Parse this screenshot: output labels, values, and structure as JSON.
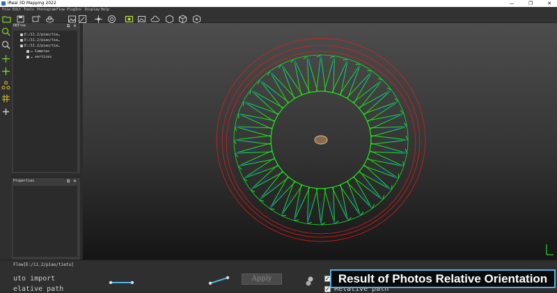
{
  "window": {
    "title": "iReal 3D Mapping 2022",
    "min_glyph": "—",
    "max_glyph": "❐",
    "close_glyph": "✕"
  },
  "menu": [
    "File",
    "Edit",
    "Tools",
    "Photogram",
    "Flow",
    "PlugIns",
    "Display",
    "Help"
  ],
  "toolbar_icons": [
    "open-folder-icon",
    "save-icon",
    "import-photos-icon",
    "cloud-add-icon",
    "image-icon",
    "edit-image-icon",
    "drone-icon",
    "target-icon",
    "photo-align-icon",
    "point-cloud-icon",
    "cloud-icon",
    "cube-icon",
    "cube-grid-icon",
    "settings-cube-icon"
  ],
  "left_tools": [
    "zoom-fit-icon",
    "zoom-icon",
    "crosshair-icon",
    "move-icon",
    "connect-points-icon",
    "grid-icon",
    "add-point-icon"
  ],
  "dbtree": {
    "title": "DBTree",
    "float_glyph": "⧉",
    "close_glyph": "✕",
    "rows": [
      "E:/11.2/piao/tie…",
      "E:/11.2/piao/tie…",
      "E:/11.2/piao/tie…",
      "Cameras",
      "vertices"
    ]
  },
  "properties": {
    "title": "Properties",
    "float_glyph": "⧉",
    "close_glyph": "✕"
  },
  "flow": {
    "title": "Flow[E:/11.2/piao/tietu]",
    "line1": "uto import",
    "line2": "elative path",
    "apply_label": "Apply",
    "option_label": "Relative path"
  },
  "caption": "Result of Photos Relative Orientation",
  "colors": {
    "camera_frustum": "#19e619",
    "camera_axis": "#1c2fd6",
    "bbox_ring": "#e21b1b",
    "caption_border": "#4fb3e8"
  }
}
